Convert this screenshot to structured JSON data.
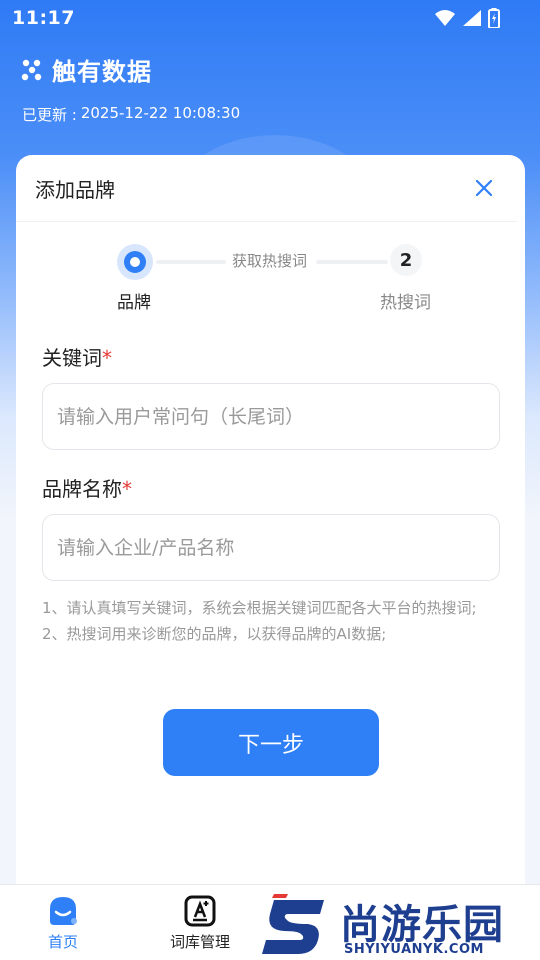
{
  "status_bar": {
    "time": "11:17"
  },
  "brand": {
    "name": "触有数据"
  },
  "updated": {
    "label": "已更新 :",
    "datetime": "2025-12-22 10:08:30"
  },
  "dialog": {
    "title": "添加品牌",
    "steps": {
      "step1_label": "品牌",
      "middle_label": "获取热搜词",
      "step2_number": "2",
      "step2_label": "热搜词"
    },
    "fields": {
      "keyword": {
        "label": "关键词",
        "required_mark": "*",
        "placeholder": "请输入用户常问句（长尾词）",
        "value": ""
      },
      "brand_name": {
        "label": "品牌名称",
        "required_mark": "*",
        "placeholder": "请输入企业/产品名称",
        "value": ""
      }
    },
    "notes": [
      "1、请认真填写关键词，系统会根据关键词匹配各大平台的热搜词;",
      "2、热搜词用来诊断您的品牌，以获得品牌的AI数据;"
    ],
    "next_button": "下一步"
  },
  "tabbar": {
    "home_label": "首页",
    "words_label": "词库管理"
  },
  "watermark": {
    "title": "尚游乐园",
    "domain": "SHYIYUANYK.COM"
  },
  "colors": {
    "primary": "#2f80f6",
    "required": "#e53935",
    "watermark": "#1e3e8f"
  }
}
